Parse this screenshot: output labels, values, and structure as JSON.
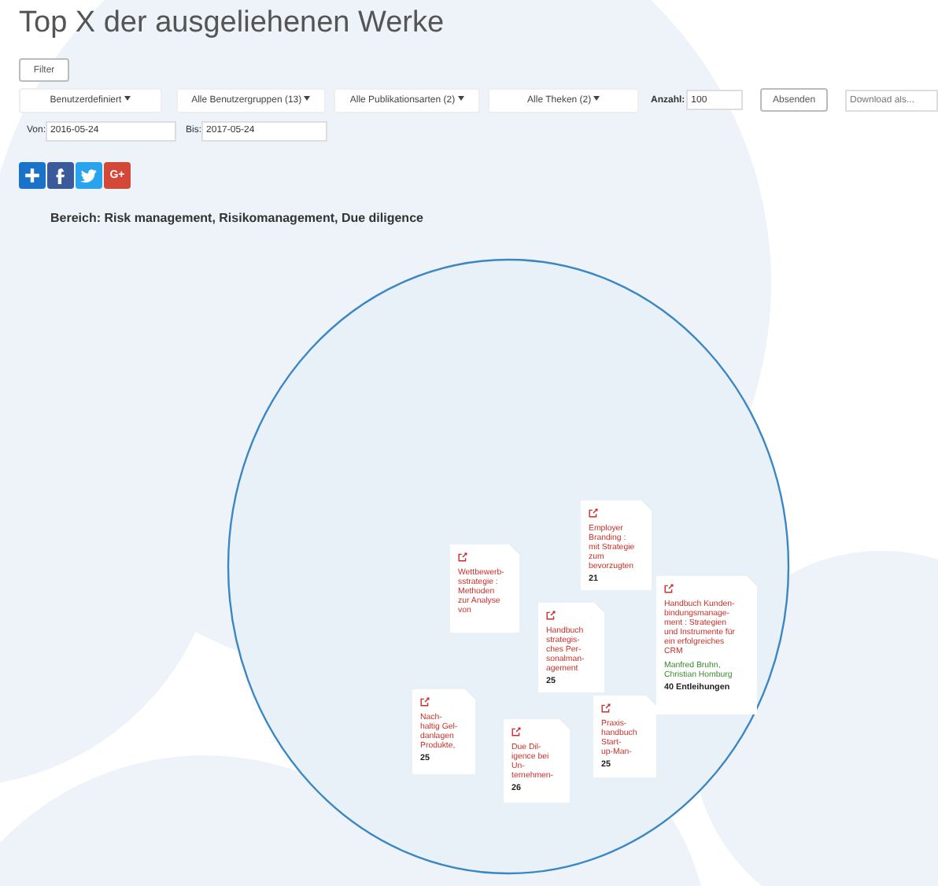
{
  "title": "Top X der ausgeliehenen Werke",
  "filter_button": "Filter",
  "dropdowns": [
    "Benutzerdefiniert",
    "Alle Benutzergruppen (13)",
    "Alle Publikationsarten (2)",
    "Alle Theken (2)"
  ],
  "count": {
    "label": "Anzahl:",
    "value": "100"
  },
  "submit_button": "Absenden",
  "download": {
    "placeholder": "Download als..."
  },
  "dates": [
    {
      "label": "Von:",
      "value": "2016-05-24"
    },
    {
      "label": "Bis:",
      "value": "2017-05-24"
    }
  ],
  "share_buttons": [
    {
      "kind": "plus"
    },
    {
      "kind": "facebook"
    },
    {
      "kind": "twitter"
    },
    {
      "kind": "google",
      "label": "G+"
    }
  ],
  "area": "Bereich: Risk management, Risikomanagement, Due diligence",
  "works": [
    {
      "title": "Wettbewerb-\nsstrategie :\nMethoden\nzur Analyse\nvon"
    },
    {
      "title": "Employer\nBranding :\nmit Strategie\nzum\nbevorzugten",
      "count": "21"
    },
    {
      "title": "Handbuch\nstrategis-\nches Per-\nsonalman-\nagement",
      "count": "25"
    },
    {
      "title": "Handbuch Kunden-\nbindungsmanage-\nment : Strategien\nund Instrumente für\nein erfolgreiches\nCRM",
      "authors": "Manfred Bruhn,\nChristian Homburg",
      "count": "40 Entleihungen"
    },
    {
      "title": "Nach-\nhaltig Gel-\ndanlagen\nProdukte,",
      "count": "25"
    },
    {
      "title": "Due Dil-\nigence bei\nUn-\nternehmen-",
      "count": "26"
    },
    {
      "title": "Praxis-\nhandbuch\nStart-\nup-Man-",
      "count": "25"
    }
  ]
}
